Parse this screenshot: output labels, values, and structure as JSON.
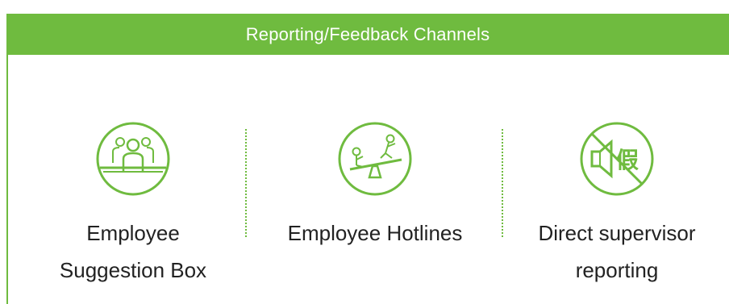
{
  "header": {
    "title": "Reporting/Feedback Channels"
  },
  "channels": [
    {
      "icon": "group-people-icon",
      "label_line1": "Employee",
      "label_line2": "Suggestion Box"
    },
    {
      "icon": "seesaw-playground-icon",
      "label_line1": "Employee Hotlines",
      "label_line2": ""
    },
    {
      "icon": "speaker-fake-prohibited-icon",
      "label_line1": "Direct supervisor",
      "label_line2": "reporting",
      "icon_glyph": "假"
    }
  ],
  "colors": {
    "accent": "#6fbb3f",
    "text": "#222222",
    "background": "#ffffff"
  }
}
